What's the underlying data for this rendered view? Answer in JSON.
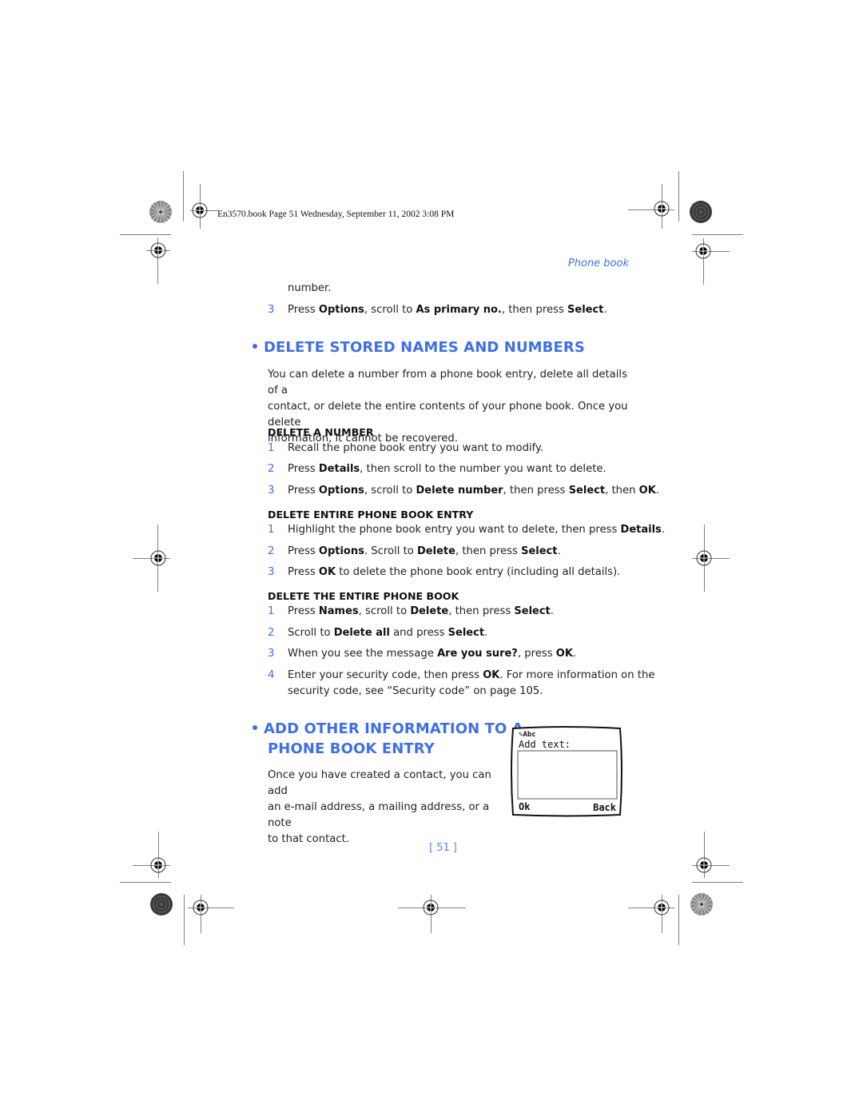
{
  "print_info": "En3570.book  Page 51  Wednesday, September 11, 2002  3:08 PM",
  "running_head": "Phone book",
  "intro": {
    "continuation": "number.",
    "step": {
      "num": "3",
      "parts": [
        "Press ",
        "Options",
        ", scroll to ",
        "As primary no.",
        ", then press ",
        "Select",
        "."
      ]
    }
  },
  "section1": {
    "title": "DELETE STORED NAMES AND NUMBERS",
    "paragraph_lines": [
      "You can delete a number from a phone book entry, delete all details of a",
      "contact, or delete the entire contents of your phone book. Once you delete",
      "information, it cannot be recovered."
    ],
    "sub1": {
      "title": "DELETE A NUMBER",
      "steps": [
        {
          "num": "1",
          "parts": [
            "Recall the phone book entry you want to modify."
          ]
        },
        {
          "num": "2",
          "parts": [
            "Press ",
            "Details",
            ", then scroll to the number you want to delete."
          ]
        },
        {
          "num": "3",
          "parts": [
            "Press ",
            "Options",
            ", scroll to ",
            "Delete number",
            ", then press ",
            "Select",
            ", then ",
            "OK",
            "."
          ]
        }
      ]
    },
    "sub2": {
      "title": "DELETE ENTIRE PHONE BOOK ENTRY",
      "steps": [
        {
          "num": "1",
          "parts": [
            "Highlight the phone book entry you want to delete, then press ",
            "Details",
            "."
          ]
        },
        {
          "num": "2",
          "parts": [
            "Press ",
            "Options",
            ". Scroll to ",
            "Delete",
            ", then press ",
            "Select",
            "."
          ]
        },
        {
          "num": "3",
          "parts": [
            "Press ",
            "OK",
            " to delete the phone book entry (including all details)."
          ]
        }
      ]
    },
    "sub3": {
      "title": "DELETE THE ENTIRE PHONE BOOK",
      "steps": [
        {
          "num": "1",
          "parts": [
            "Press ",
            "Names",
            ", scroll to ",
            "Delete",
            ", then press ",
            "Select",
            "."
          ]
        },
        {
          "num": "2",
          "parts": [
            "Scroll to ",
            "Delete all",
            " and press ",
            "Select",
            "."
          ]
        },
        {
          "num": "3",
          "parts": [
            "When you see the message ",
            "Are you sure?",
            ", press ",
            "OK",
            "."
          ]
        },
        {
          "num": "4",
          "parts": [
            "Enter your security code, then press ",
            "OK",
            ". For more information on the"
          ],
          "line2": "security code, see “Security code” on page 105."
        }
      ]
    }
  },
  "section2": {
    "title_lines": [
      "ADD OTHER INFORMATION TO A",
      "PHONE BOOK ENTRY"
    ],
    "paragraph_lines": [
      "Once you have created a contact, you can add",
      "an e-mail address, a mailing address, or a note",
      "to that contact."
    ]
  },
  "phone_screen": {
    "mode_indicator": "Abc",
    "prompt": "Add text:",
    "left_softkey": "Ok",
    "right_softkey": "Back"
  },
  "page_number": "[ 51 ]",
  "colors": {
    "accent": "#3f6fe8",
    "page_number": "#5a86f0",
    "text": "#222222"
  }
}
